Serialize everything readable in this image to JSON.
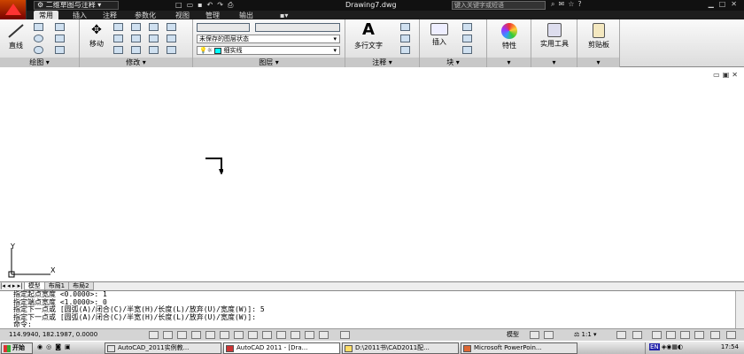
{
  "title_bar": {
    "workspace": "二维草图与注释",
    "document_title": "Drawing7.dwg",
    "search_placeholder": "键入关键字或短语"
  },
  "ribbon_tabs": [
    "常用",
    "插入",
    "注释",
    "参数化",
    "视图",
    "管理",
    "输出"
  ],
  "panels": {
    "draw": {
      "title": "绘图",
      "line_label": "直线"
    },
    "modify": {
      "title": "修改",
      "move_label": "移动"
    },
    "layers": {
      "title": "图层",
      "layer_state": "未保存的图层状态",
      "current_layer": "细实线"
    },
    "annotation": {
      "title": "注释",
      "mtext_label": "多行文字"
    },
    "block": {
      "title": "块",
      "insert_label": "插入"
    },
    "properties": {
      "label": "特性"
    },
    "utilities": {
      "label": "实用工具"
    },
    "clipboard": {
      "label": "剪贴板"
    }
  },
  "layout_tabs": [
    "模型",
    "布局1",
    "布局2"
  ],
  "command_lines": [
    "指定起点宽度 <0.0000>: 1",
    "指定端点宽度 <1.0000>: 0",
    "指定下一点或 [圆弧(A)/闭合(C)/半宽(H)/长度(L)/放弃(U)/宽度(W)]: 5",
    "指定下一点或 [圆弧(A)/闭合(C)/半宽(H)/长度(L)/放弃(U)/宽度(W)]:",
    "命令:"
  ],
  "status_bar": {
    "coordinates": "114.9940, 182.1987, 0.0000",
    "model_label": "模型",
    "annotation_scale": "1:1"
  },
  "taskbar": {
    "start_label": "开始",
    "tasks": [
      "AutoCAD_2011实例教...",
      "AutoCAD 2011 - [Dra...",
      "D:\\2011书\\CAD2011配...",
      "Microsoft PowerPoin..."
    ],
    "language": "EN",
    "clock": "17:54"
  },
  "ucs": {
    "x_label": "X",
    "y_label": "Y"
  },
  "colors": {
    "title_bg": "#111111",
    "ribbon_bg": "#e6e6e6",
    "layer_swatch": "#00ffff"
  }
}
